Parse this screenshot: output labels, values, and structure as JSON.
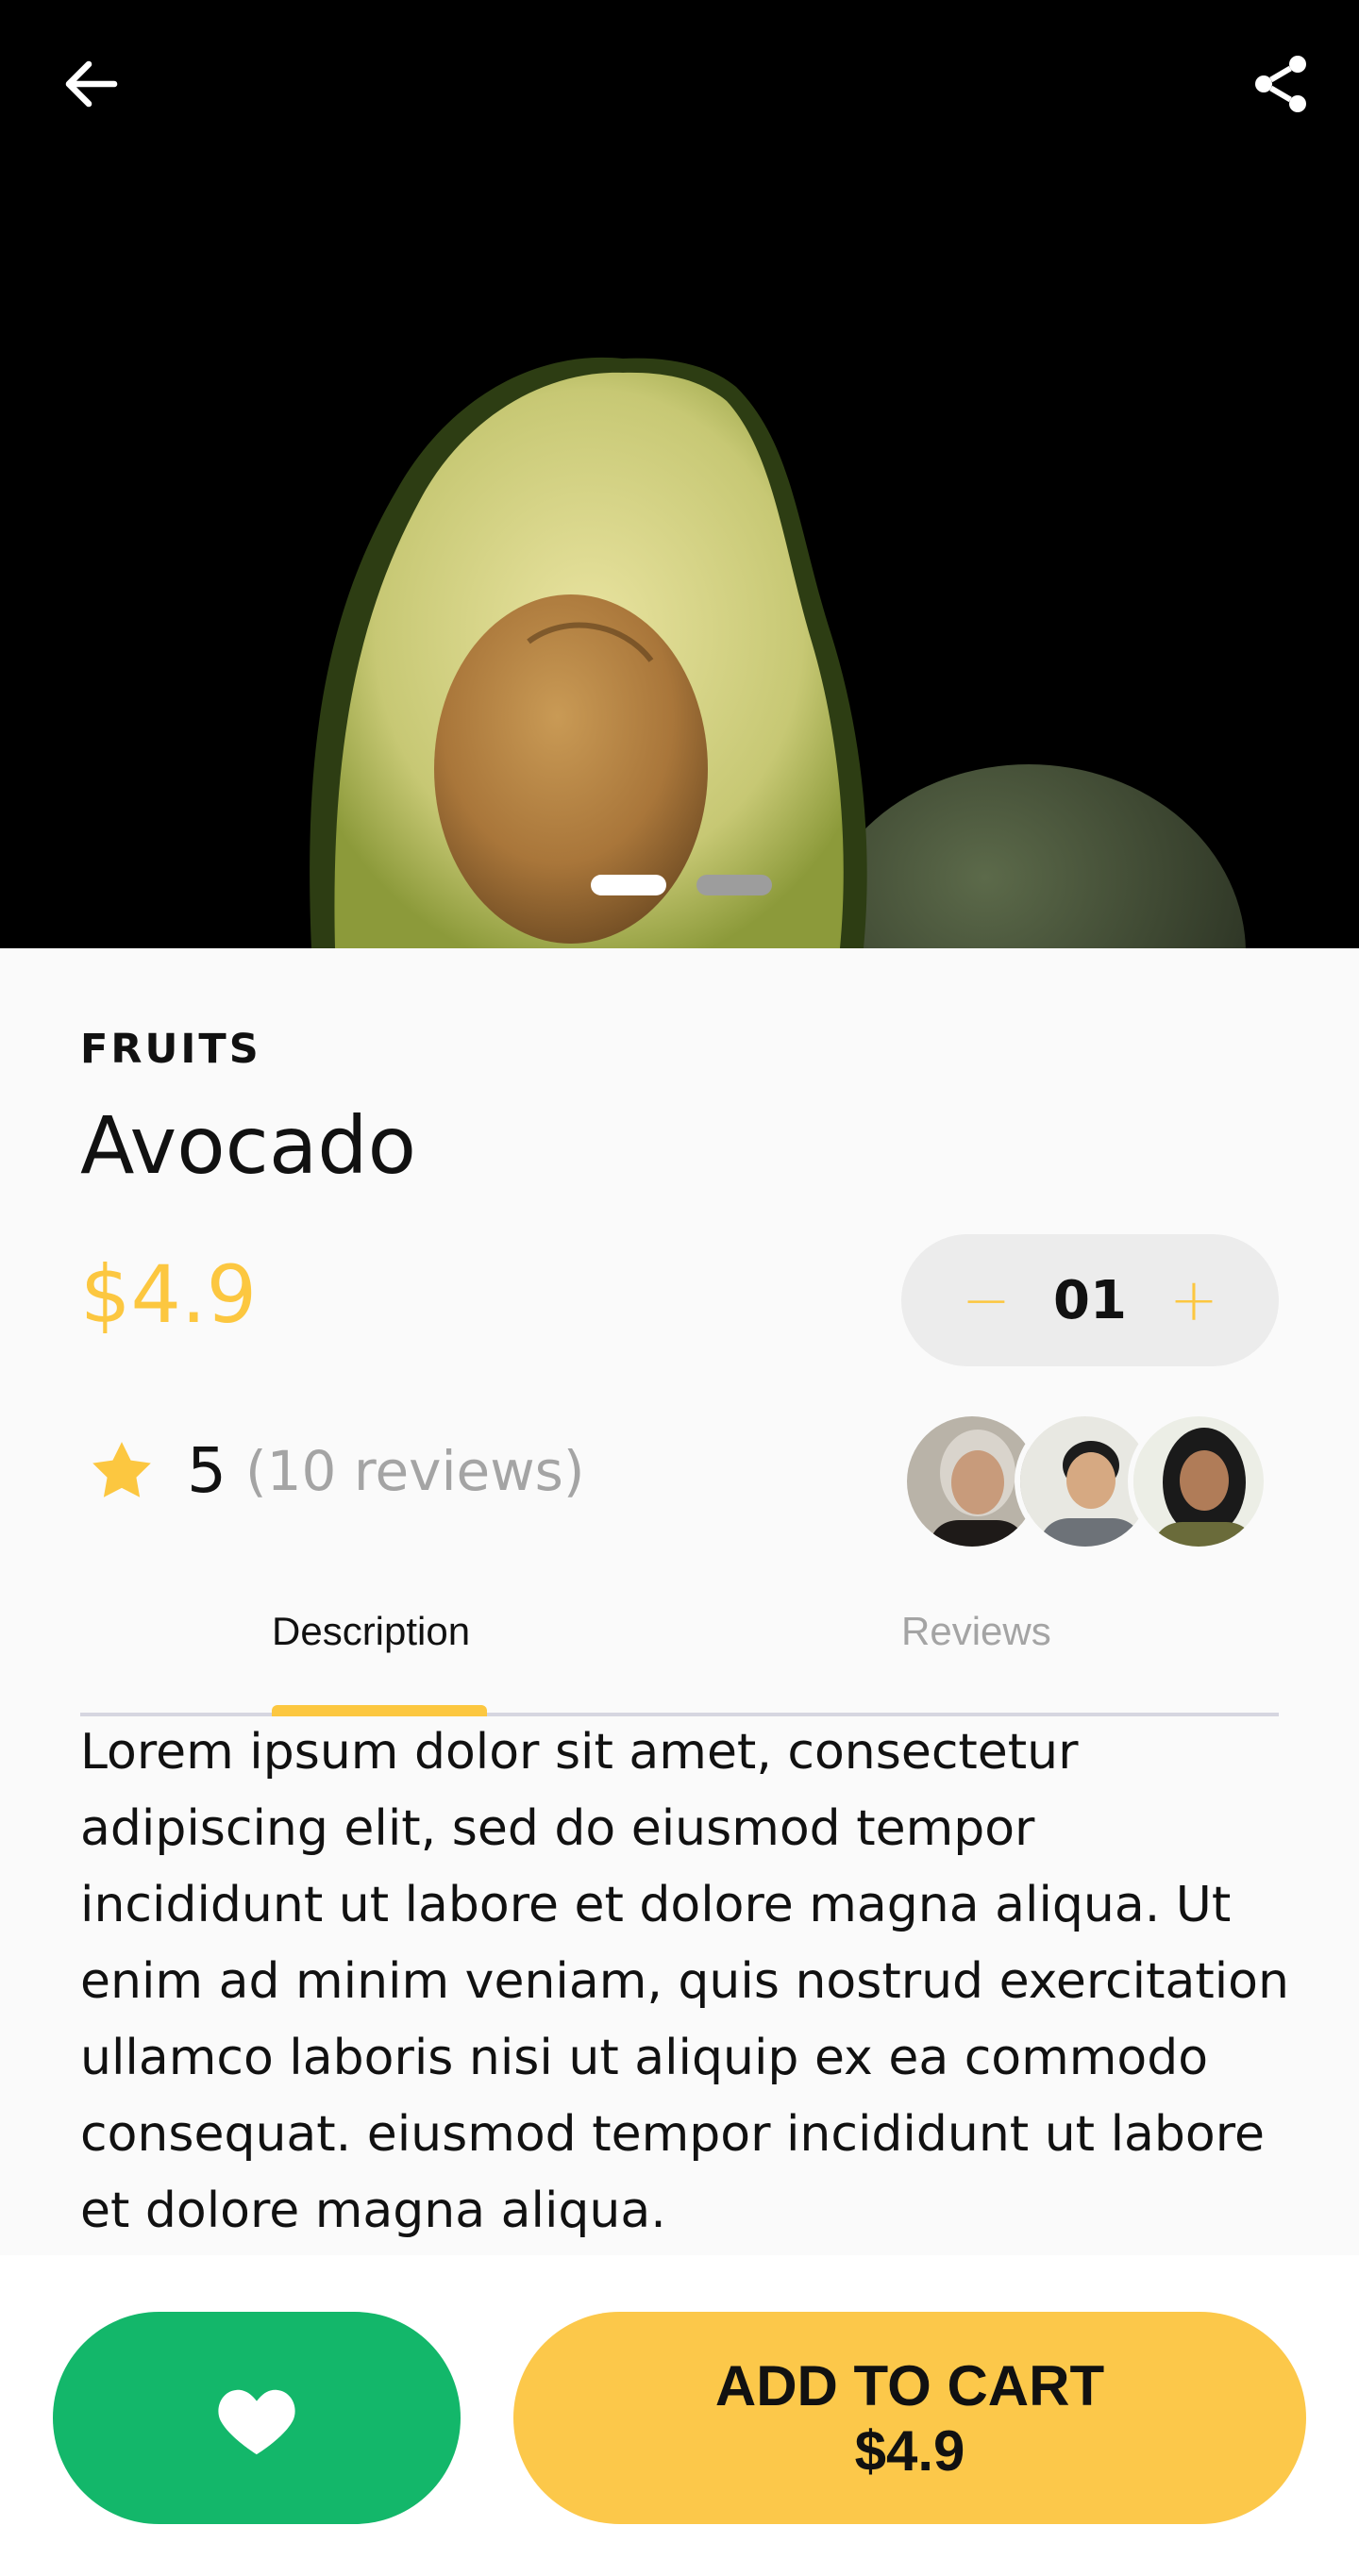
{
  "hero": {
    "back_icon": "arrow-left-icon",
    "share_icon": "share-icon",
    "carousel": {
      "count": 2,
      "active_index": 0
    }
  },
  "product": {
    "category": "FRUITS",
    "name": "Avocado",
    "price": "$4.9",
    "quantity": "01",
    "decrement_label": "−",
    "increment_label": "+"
  },
  "rating": {
    "score": "5",
    "count_text": "(10 reviews)"
  },
  "reviewers": [
    "reviewer-avatar-1",
    "reviewer-avatar-2",
    "reviewer-avatar-3"
  ],
  "tabs": [
    {
      "label": "Description",
      "active": true
    },
    {
      "label": "Reviews",
      "active": false
    }
  ],
  "description": "Lorem ipsum dolor sit amet, consectetur adipiscing elit, sed do eiusmod tempor incididunt ut labore et dolore magna aliqua. Ut enim ad minim veniam, quis nostrud exercitation ullamco laboris nisi ut aliquip ex ea commodo consequat.   eiusmod tempor incididunt ut labore et dolore magna aliqua.",
  "actions": {
    "favorite_icon": "heart-icon",
    "cart_line1": "ADD TO CART",
    "cart_line2": "$4.9"
  },
  "colors": {
    "accent": "#fcc740",
    "favorite": "#13b76a",
    "muted": "#a4a4a4"
  }
}
